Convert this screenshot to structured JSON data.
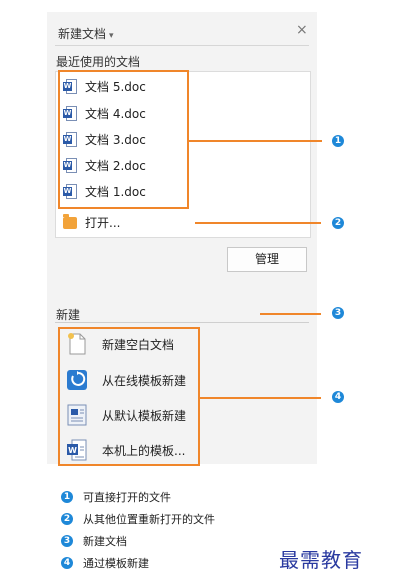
{
  "panel": {
    "title": "新建文档",
    "close_glyph": "×"
  },
  "recent": {
    "label": "最近使用的文档",
    "files": [
      "文档 5.doc",
      "文档 4.doc",
      "文档 3.doc",
      "文档 2.doc",
      "文档 1.doc"
    ],
    "open_label": "打开...",
    "manage_label": "管理"
  },
  "new_section": {
    "label": "新建",
    "items": [
      "新建空白文档",
      "从在线模板新建",
      "从默认模板新建",
      "本机上的模板..."
    ]
  },
  "callouts": [
    "1",
    "2",
    "3",
    "4"
  ],
  "legend": [
    {
      "num": "1",
      "text": "可直接打开的文件"
    },
    {
      "num": "2",
      "text": "从其他位置重新打开的文件"
    },
    {
      "num": "3",
      "text": "新建文档"
    },
    {
      "num": "4",
      "text": "通过模板新建"
    }
  ],
  "watermark": "最需教育",
  "colors": {
    "accent_orange": "#f0862a",
    "badge_blue": "#1e88d8",
    "word_blue": "#2b5aa8",
    "folder_orange": "#f2a33a"
  }
}
